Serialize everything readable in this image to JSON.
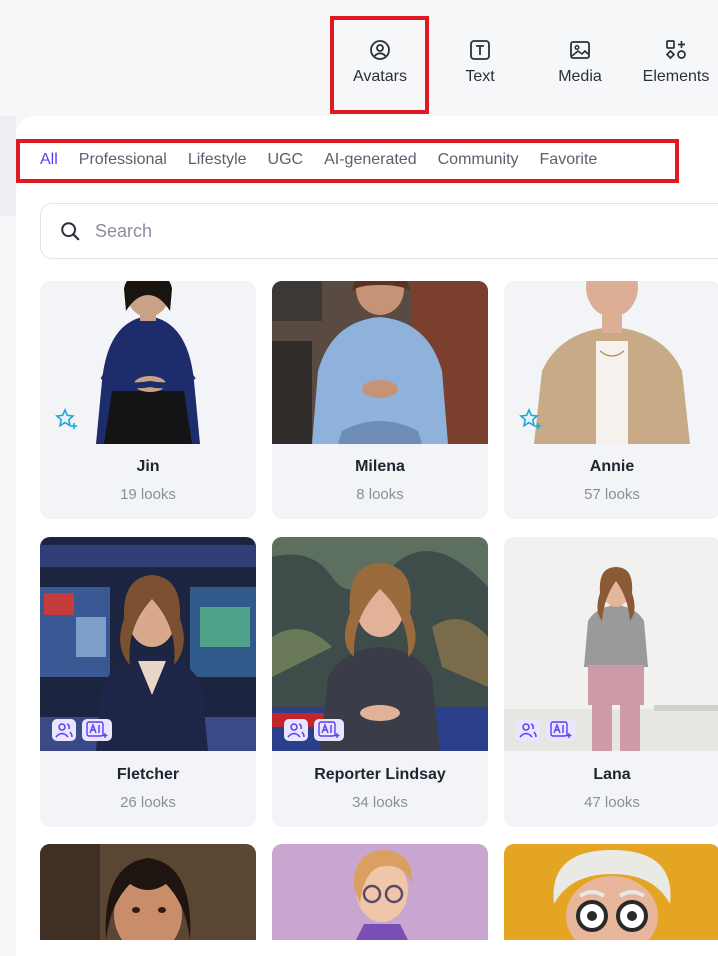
{
  "toolbar": {
    "items": [
      {
        "label": "Avatars",
        "icon": "avatar-icon"
      },
      {
        "label": "Text",
        "icon": "text-icon"
      },
      {
        "label": "Media",
        "icon": "media-icon"
      },
      {
        "label": "Elements",
        "icon": "elements-icon"
      }
    ]
  },
  "filters": [
    "All",
    "Professional",
    "Lifestyle",
    "UGC",
    "AI-generated",
    "Community",
    "Favorite"
  ],
  "active_filter": "All",
  "search": {
    "placeholder": "Search",
    "value": ""
  },
  "avatars": [
    {
      "name": "Jin",
      "looks": "19 looks"
    },
    {
      "name": "Milena",
      "looks": "8 looks"
    },
    {
      "name": "Annie",
      "looks": "57 looks"
    },
    {
      "name": "Fletcher",
      "looks": "26 looks"
    },
    {
      "name": "Reporter Lindsay",
      "looks": "34 looks"
    },
    {
      "name": "Lana",
      "looks": "47 looks"
    },
    {
      "name": "",
      "looks": ""
    },
    {
      "name": "",
      "looks": ""
    },
    {
      "name": "",
      "looks": ""
    }
  ],
  "colors": {
    "highlight": "#e01822",
    "accent": "#5b3df5",
    "badge_bg": "#e9e6ff",
    "star": "#19a7e0"
  }
}
